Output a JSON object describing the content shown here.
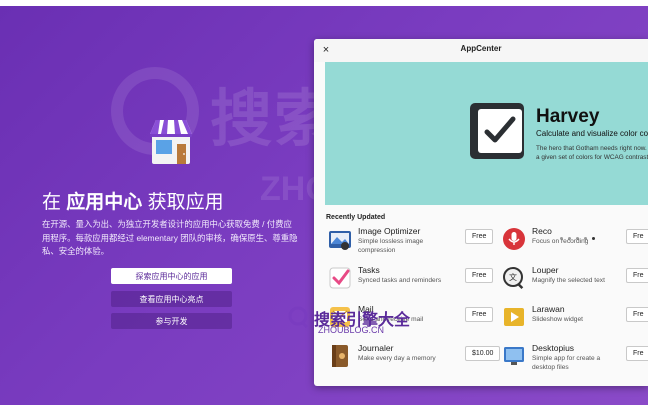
{
  "intro": {
    "title_prefix": "在 ",
    "title_bold": "应用中心",
    "title_suffix": " 获取应用",
    "description": "在开源、量入为出、为独立开发者设计的应用中心获取免费 / 付费应用程序。每款应用都经过 elementary 团队的审核，确保原生、尊重隐私、安全的体验。",
    "buttons": [
      "探索应用中心的应用",
      "查看应用中心亮点",
      "参与开发"
    ]
  },
  "window": {
    "title": "AppCenter",
    "close_glyph": "×",
    "banner": {
      "name": "Harvey",
      "summary": "Calculate and visualize color cont",
      "description_line1": "The hero that Gotham needs right now.",
      "description_line2": "a given set of colors for WCAG contrast",
      "dots": 5,
      "active_dot": 4
    },
    "section_title": "Recently Updated",
    "apps_left": [
      {
        "name": "Image Optimizer",
        "summary": "Simple lossless image compression",
        "price": "Free",
        "icon": "image-optimizer-icon",
        "color": "#2f5fa8"
      },
      {
        "name": "Tasks",
        "summary": "Synced tasks and reminders",
        "price": "Free",
        "icon": "tasks-icon",
        "color": "#e84a86"
      },
      {
        "name": "Mail",
        "summary": "Send and receive mail",
        "price": "Free",
        "icon": "mail-icon",
        "color": "#f5c14a"
      },
      {
        "name": "Journaler",
        "summary": "Make every day a memory",
        "price": "$10.00",
        "icon": "journaler-icon",
        "color": "#8a5a2a"
      }
    ],
    "apps_right": [
      {
        "name": "Reco",
        "summary": "Focus on recording",
        "price": "Fre",
        "icon": "microphone-icon",
        "color": "#d8343a"
      },
      {
        "name": "Louper",
        "summary": "Magnify the selected text",
        "price": "Fre",
        "icon": "magnifier-icon",
        "color": "#f0f0f0"
      },
      {
        "name": "Larawan",
        "summary": "Slideshow widget",
        "price": "Fre",
        "icon": "slideshow-icon",
        "color": "#e8b42a"
      },
      {
        "name": "Desktopius",
        "summary": "Simple app for create a desktop files",
        "price": "Fre",
        "icon": "desktop-icon",
        "color": "#3a78c8"
      }
    ]
  },
  "watermark": {
    "big": "搜索引擎大全",
    "big_sub": "ZHOUBLOG.CN",
    "small": "搜索引擎大全",
    "small_sub": "ZHOUBLOG.CN"
  }
}
